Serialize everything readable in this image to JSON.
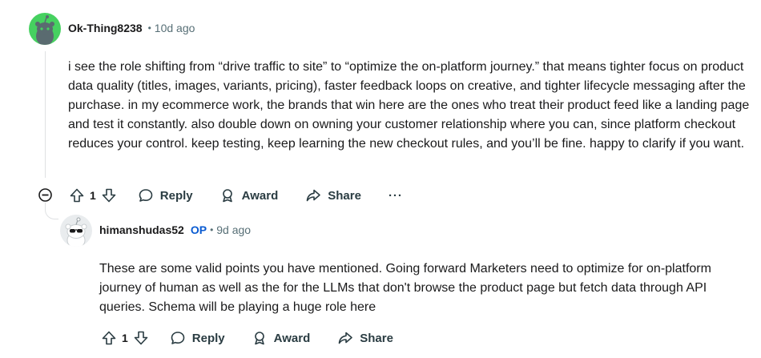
{
  "comments": [
    {
      "author": "Ok-Thing8238",
      "time": "10d ago",
      "body": "i see the role shifting from “drive traffic to site” to “optimize the on-platform journey.” that means tighter focus on product data quality (titles, images, variants, pricing), faster feedback loops on creative, and tighter lifecycle messaging after the purchase. in my ecommerce work, the brands that win here are the ones who treat their product feed like a landing page and test it constantly. also double down on owning your customer relationship where you can, since platform checkout reduces your control. keep testing, keep learning the new checkout rules, and you’ll be fine. happy to clarify if you want.",
      "score": "1",
      "reply_label": "Reply",
      "award_label": "Award",
      "share_label": "Share",
      "more_label": "···"
    },
    {
      "author": "himanshudas52",
      "op_badge": "OP",
      "time": "9d ago",
      "body": "These are some valid points you have mentioned. Going forward Marketers need to optimize for on-platform journey of human as well as the for the LLMs that don't browse the product page but fetch data through API queries. Schema will be playing a huge role here",
      "score": "1",
      "reply_label": "Reply",
      "award_label": "Award",
      "share_label": "Share"
    }
  ],
  "separator": "•",
  "colors": {
    "avatar1_bg": "#46d160",
    "op": "#0a5bd1",
    "meta": "#576f76"
  }
}
